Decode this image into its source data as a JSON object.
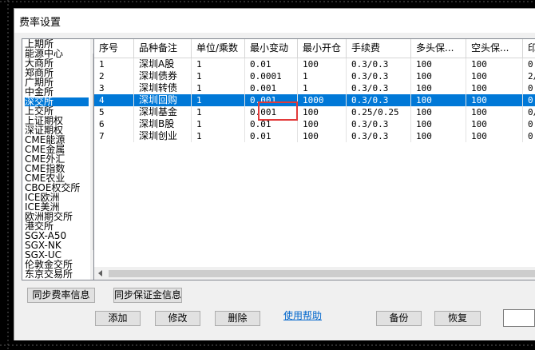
{
  "window": {
    "title": "费率设置"
  },
  "exchanges": [
    "上期所",
    "能源中心",
    "大商所",
    "郑商所",
    "广期所",
    "中金所",
    "深交所",
    "上交所",
    "上证期权",
    "深证期权",
    "CME能源",
    "CME金属",
    "CME外汇",
    "CME指数",
    "CME农业",
    "CBOE权交所",
    "ICE欧洲",
    "ICE美洲",
    "欧洲期交所",
    "港交所",
    "SGX-A50",
    "SGX-NK",
    "SGX-UC",
    "伦敦金交所",
    "东京交易所"
  ],
  "selected_exchange": "深交所",
  "table": {
    "columns": [
      "序号",
      "品种备注",
      "单位/乘数",
      "最小变动",
      "最小开仓",
      "手续费",
      "多头保...",
      "空头保...",
      "印"
    ],
    "rows": [
      [
        "1",
        "深圳A股",
        "1",
        "0.01",
        "100",
        "0.3/0.3",
        "100",
        "100",
        "0."
      ],
      [
        "2",
        "深圳债券",
        "1",
        "0.0001",
        "1",
        "0.3/0.3",
        "100",
        "100",
        "2/"
      ],
      [
        "3",
        "深圳转债",
        "1",
        "0.001",
        "1",
        "0.3/0.3",
        "100",
        "100",
        "0."
      ],
      [
        "4",
        "深圳回购",
        "1",
        "0.001",
        "1000",
        "0.3/0.3",
        "100",
        "100",
        "0."
      ],
      [
        "5",
        "深圳基金",
        "1",
        "0.001",
        "100",
        "0.25/0.25",
        "100",
        "100",
        "0/"
      ],
      [
        "6",
        "深圳B股",
        "1",
        "0.01",
        "100",
        "0.3/0.3",
        "100",
        "100",
        "0."
      ],
      [
        "7",
        "深圳创业",
        "1",
        "0.01",
        "100",
        "0.3/0.3",
        "100",
        "100",
        "0."
      ]
    ],
    "selected_row": "4",
    "highlighted_value": "0.001"
  },
  "buttons": {
    "sync_rates": "同步费率信息",
    "sync_margin": "同步保证金信息",
    "add": "添加",
    "edit": "修改",
    "delete": "删除",
    "help": "使用帮助",
    "backup": "备份",
    "restore": "恢复"
  },
  "colors": {
    "selection": "#0078d7",
    "highlight_box": "#e23a3a",
    "link": "#0066cc"
  }
}
